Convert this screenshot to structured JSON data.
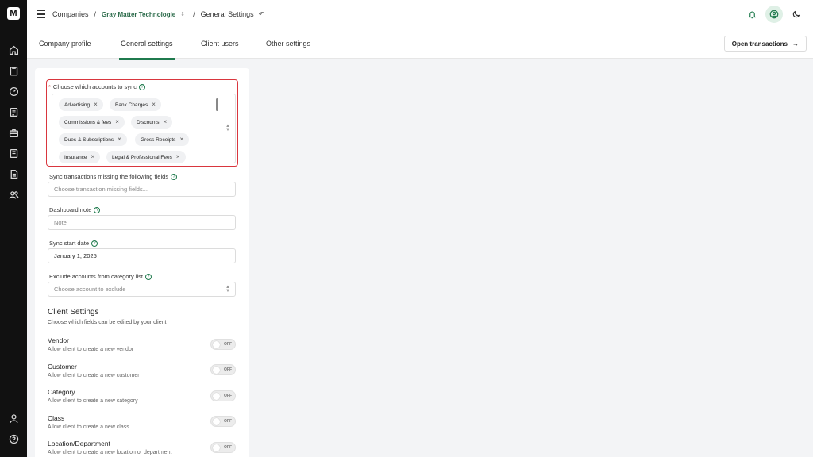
{
  "rail": {
    "logo_text": "M",
    "icons": [
      "home-icon",
      "clipboard-icon",
      "gauge-icon",
      "report-icon",
      "briefcase-icon",
      "document-icon",
      "file-list-icon",
      "users-icon"
    ],
    "bottom_icons": [
      "user-icon",
      "help-icon"
    ]
  },
  "header": {
    "breadcrumb": {
      "companies": "Companies",
      "company": "Gray Matter Technologie",
      "page": "General Settings"
    }
  },
  "tabs": [
    {
      "label": "Company profile",
      "active": false
    },
    {
      "label": "General settings",
      "active": true
    },
    {
      "label": "Client users",
      "active": false
    },
    {
      "label": "Other settings",
      "active": false
    }
  ],
  "open_transactions_label": "Open transactions",
  "form": {
    "sync_accounts": {
      "label": "Choose which accounts to sync",
      "required_mark": "*",
      "chips": [
        "Advertising",
        "Bank Charges",
        "Commissions & fees",
        "Discounts",
        "Dues & Subscriptions",
        "Gross Receipts",
        "Insurance",
        "Legal & Professional Fees"
      ]
    },
    "missing_fields": {
      "label": "Sync transactions missing the following fields",
      "placeholder": "Choose transaction missing fields..."
    },
    "dashboard_note": {
      "label": "Dashboard note",
      "placeholder": "Note"
    },
    "sync_start_date": {
      "label": "Sync start date",
      "value": "January 1, 2025"
    },
    "exclude_accounts": {
      "label": "Exclude accounts from category list",
      "placeholder": "Choose account to exclude"
    }
  },
  "client_settings": {
    "title": "Client Settings",
    "subtitle": "Choose which fields can be edited by your client",
    "toggle_off_label": "OFF",
    "items": [
      {
        "title": "Vendor",
        "desc": "Allow client to create a new vendor",
        "state": "off"
      },
      {
        "title": "Customer",
        "desc": "Allow client to create a new customer",
        "state": "off"
      },
      {
        "title": "Category",
        "desc": "Allow client to create a new category",
        "state": "off"
      },
      {
        "title": "Class",
        "desc": "Allow client to create a new class",
        "state": "off"
      },
      {
        "title": "Location/Department",
        "desc": "Allow client to create a new location or department",
        "state": "off"
      }
    ]
  },
  "colors": {
    "accent": "#1f7a4d",
    "error_outline": "#d9363e",
    "rail": "#111111"
  }
}
